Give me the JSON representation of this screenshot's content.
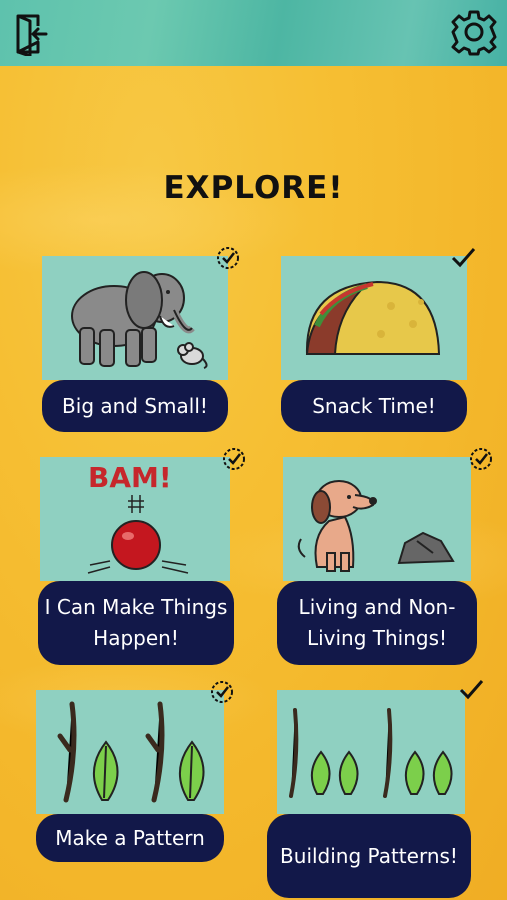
{
  "screen": {
    "title": "EXPLORE!"
  },
  "topbar": {
    "exit_icon": "exit-door-icon",
    "settings_icon": "gear-icon"
  },
  "colors": {
    "topbar": "#5ec2ad",
    "background": "#f6bf33",
    "art_panel": "#8fd0c1",
    "label_bg": "#121849",
    "label_text": "#ffffff"
  },
  "activities": [
    {
      "label": "Big and Small!",
      "status": "in-progress",
      "image": "elephant-and-mouse"
    },
    {
      "label": "Snack Time!",
      "status": "complete",
      "image": "taco"
    },
    {
      "label": "I Can Make Things Happen!",
      "status": "in-progress",
      "image": "bouncing-ball",
      "art_text": "BAM!"
    },
    {
      "label": "Living and Non-Living Things!",
      "status": "in-progress",
      "image": "dog-and-rock"
    },
    {
      "label": "Make a Pattern",
      "status": "in-progress",
      "image": "stick-leaf-pattern"
    },
    {
      "label": "Building Patterns!",
      "status": "complete",
      "image": "stick-leaf-leaf-pattern"
    }
  ]
}
